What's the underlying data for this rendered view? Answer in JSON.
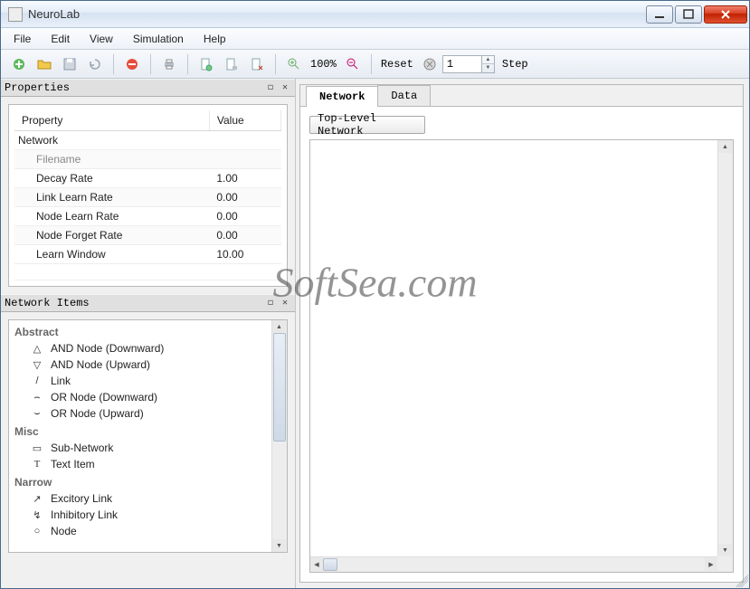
{
  "window": {
    "title": "NeuroLab"
  },
  "menu": {
    "items": [
      "File",
      "Edit",
      "View",
      "Simulation",
      "Help"
    ]
  },
  "toolbar": {
    "zoom_display": "100%",
    "reset_label": "Reset",
    "step_value": "1",
    "step_label": "Step"
  },
  "panels": {
    "properties": {
      "title": "Properties",
      "columns": [
        "Property",
        "Value"
      ],
      "group": "Network",
      "rows": [
        {
          "label": "Filename",
          "value": "",
          "dim": true
        },
        {
          "label": "Decay Rate",
          "value": "1.00"
        },
        {
          "label": "Link Learn Rate",
          "value": "0.00"
        },
        {
          "label": "Node Learn Rate",
          "value": "0.00"
        },
        {
          "label": "Node Forget Rate",
          "value": "0.00"
        },
        {
          "label": "Learn Window",
          "value": "10.00"
        }
      ]
    },
    "network_items": {
      "title": "Network Items",
      "groups": [
        {
          "name": "Abstract",
          "items": [
            {
              "icon": "triangle-up",
              "label": "AND Node (Downward)"
            },
            {
              "icon": "triangle-down",
              "label": "AND Node (Upward)"
            },
            {
              "icon": "slash",
              "label": "Link"
            },
            {
              "icon": "arc-down",
              "label": "OR Node (Downward)"
            },
            {
              "icon": "arc-up",
              "label": "OR Node (Upward)"
            }
          ]
        },
        {
          "name": "Misc",
          "items": [
            {
              "icon": "box",
              "label": "Sub-Network"
            },
            {
              "icon": "t-glyph",
              "label": "Text Item"
            }
          ]
        },
        {
          "name": "Narrow",
          "items": [
            {
              "icon": "arrow-ne",
              "label": "Excitory Link"
            },
            {
              "icon": "lightning",
              "label": "Inhibitory Link"
            },
            {
              "icon": "circle",
              "label": "Node"
            }
          ]
        }
      ]
    }
  },
  "main": {
    "tabs": [
      {
        "label": "Network",
        "active": true
      },
      {
        "label": "Data",
        "active": false
      }
    ],
    "top_level_label": "Top-Level Network"
  },
  "watermark": "SoftSea.com"
}
